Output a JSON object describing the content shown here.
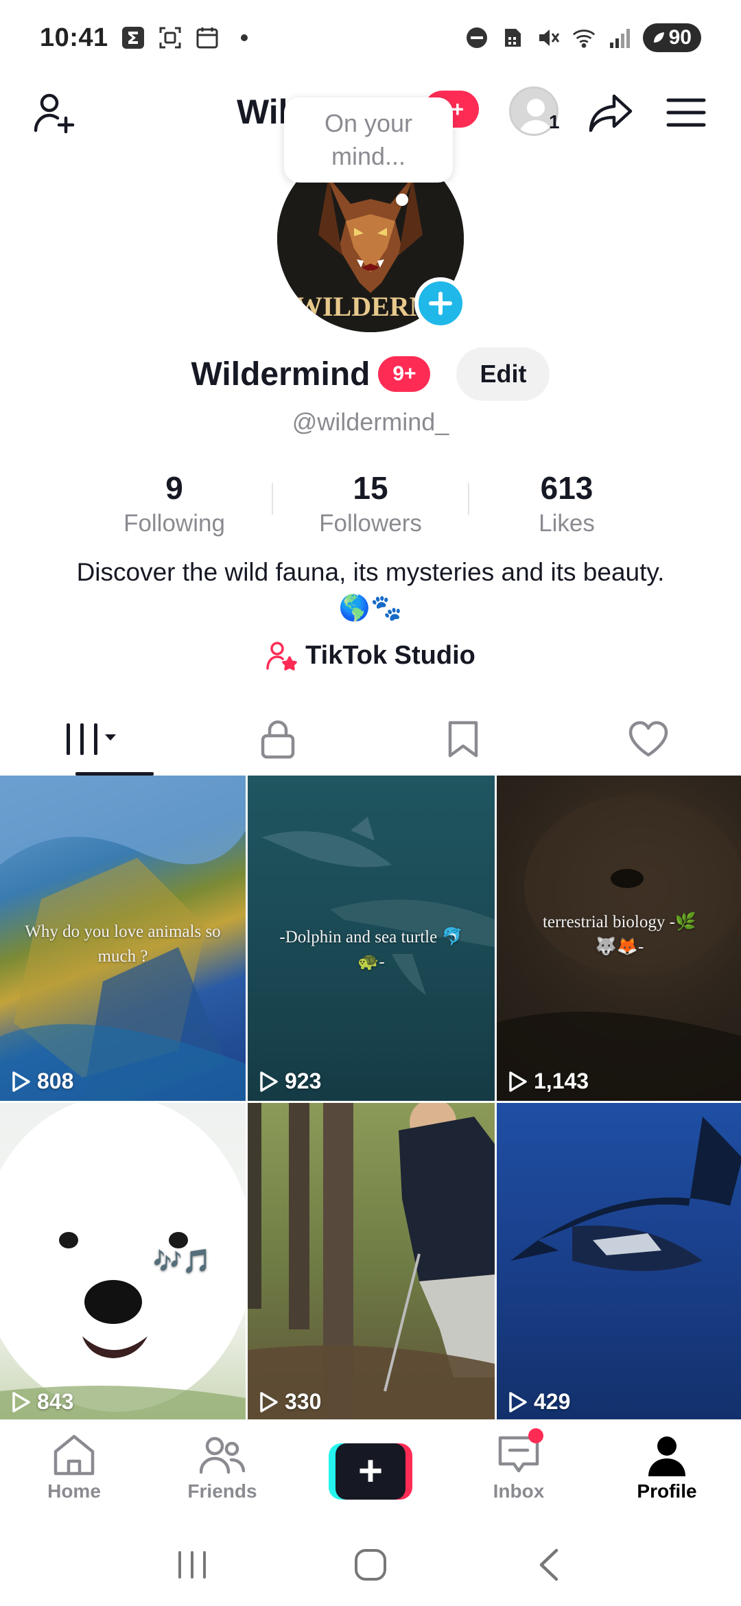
{
  "status_bar": {
    "time": "10:41",
    "left_icons": [
      "sigma-icon",
      "scan-icon",
      "calendar-icon",
      "dot-icon"
    ],
    "right_icons": [
      "dnd-icon",
      "sim-icon",
      "mute-icon",
      "wifi-icon",
      "signal-icon"
    ],
    "battery": "90"
  },
  "header": {
    "title": "Wildermi...",
    "badge": "9+",
    "avatar_count": "1"
  },
  "thought_bubble": {
    "placeholder": "On your mind..."
  },
  "profile": {
    "avatar_text": "WILDERMI",
    "name": "Wildermind",
    "badge": "9+",
    "edit_label": "Edit",
    "handle": "@wildermind_"
  },
  "stats": [
    {
      "value": "9",
      "label": "Following"
    },
    {
      "value": "15",
      "label": "Followers"
    },
    {
      "value": "613",
      "label": "Likes"
    }
  ],
  "bio": "Discover the wild fauna, its mysteries and its beauty. 🌎🐾",
  "studio_link": "TikTok Studio",
  "tabs": [
    {
      "name": "videos",
      "icon": "grid-icon",
      "active": true
    },
    {
      "name": "private",
      "icon": "lock-icon",
      "active": false
    },
    {
      "name": "favorites",
      "icon": "bookmark-icon",
      "active": false
    },
    {
      "name": "liked",
      "icon": "heart-icon",
      "active": false
    }
  ],
  "videos": [
    {
      "caption": "Why do you love animals so much ?",
      "views": "808"
    },
    {
      "caption": "-Dolphin and sea turtle 🐬🐢-",
      "views": "923"
    },
    {
      "caption": "terrestrial biology -🌿🐺🦊-",
      "views": "1,143"
    },
    {
      "caption": "🎶🎵",
      "views": "843"
    },
    {
      "caption": "",
      "views": "330"
    },
    {
      "caption": "",
      "views": "429"
    }
  ],
  "bottom_nav": {
    "home": "Home",
    "friends": "Friends",
    "create": "+",
    "inbox": "Inbox",
    "profile": "Profile"
  },
  "colors": {
    "accent": "#fe2c55",
    "cyan": "#25f4ee",
    "text_primary": "#161823",
    "text_secondary": "#8a8b91",
    "avatar_plus": "#20b8e8"
  }
}
